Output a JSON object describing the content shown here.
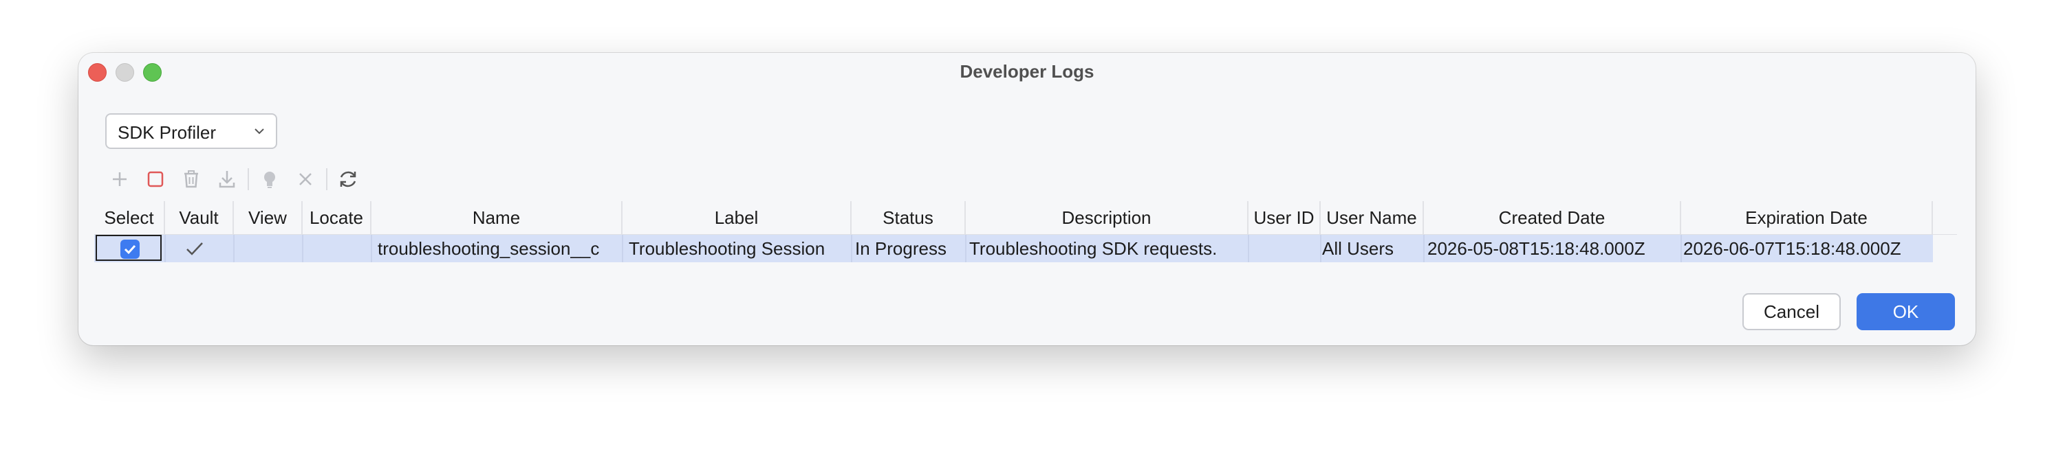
{
  "window": {
    "title": "Developer Logs"
  },
  "dropdown": {
    "selected": "SDK Profiler"
  },
  "toolbar": {
    "icons": [
      "plus-icon",
      "stop-icon",
      "trash-icon",
      "download-icon",
      "lightbulb-icon",
      "close-icon",
      "refresh-icon"
    ]
  },
  "table": {
    "columns": [
      "Select",
      "Vault",
      "View",
      "Locate",
      "Name",
      "Label",
      "Status",
      "Description",
      "User ID",
      "User Name",
      "Created Date",
      "Expiration Date"
    ],
    "rows": [
      {
        "select": true,
        "vault": true,
        "view": "",
        "locate": "",
        "name": "troubleshooting_session__c",
        "label": "Troubleshooting Session",
        "status": "In Progress",
        "description": "Troubleshooting SDK requests.",
        "user_id": "",
        "user_name": "All Users",
        "created_date": "2026-05-08T15:18:48.000Z",
        "expiration_date": "2026-06-07T15:18:48.000Z"
      }
    ]
  },
  "buttons": {
    "cancel": "Cancel",
    "ok": "OK"
  },
  "colors": {
    "accent": "#3e78e6",
    "row_selected": "#d6e0f7",
    "close": "#ec5f57",
    "maximize": "#5fc453"
  }
}
